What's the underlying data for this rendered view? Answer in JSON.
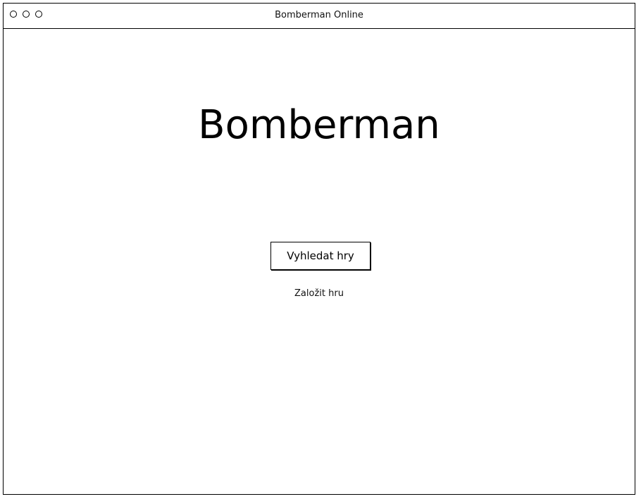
{
  "window": {
    "title": "Bomberman Online"
  },
  "main": {
    "heading": "Bomberman",
    "search_button_label": "Vyhledat hry",
    "create_game_label": "Založit hru"
  }
}
